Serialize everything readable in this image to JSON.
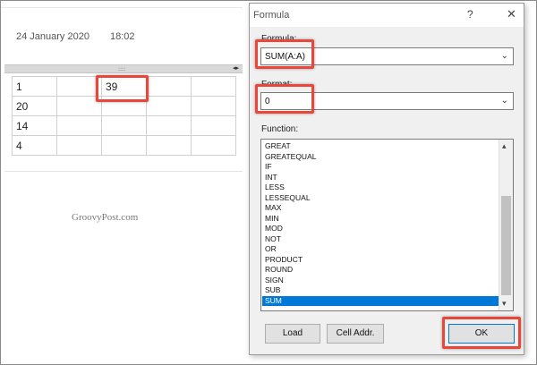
{
  "note": {
    "date": "24 January 2020",
    "time": "18:02",
    "table": [
      [
        "1",
        "",
        "39",
        "",
        ""
      ],
      [
        "20",
        "",
        "",
        "",
        ""
      ],
      [
        "14",
        "",
        "",
        "",
        ""
      ],
      [
        "4",
        "",
        "",
        "",
        ""
      ]
    ],
    "grip": "::::",
    "scroll_arrows": "◂▸"
  },
  "watermark": "GroovyPost.com",
  "dialog": {
    "title": "Formula",
    "help": "?",
    "close": "✕",
    "formula_label": "Formula:",
    "formula_value": "SUM(A:A)",
    "format_label": "Format:",
    "format_value": "0",
    "function_label": "Function:",
    "functions": [
      "GREAT",
      "GREATEQUAL",
      "IF",
      "INT",
      "LESS",
      "LESSEQUAL",
      "MAX",
      "MIN",
      "MOD",
      "NOT",
      "OR",
      "PRODUCT",
      "ROUND",
      "SIGN",
      "SUB",
      "SUM"
    ],
    "selected_function": "SUM",
    "load_button": "Load",
    "cell_addr_button": "Cell Addr.",
    "ok_button": "OK"
  },
  "icons": {
    "chevron": "⌄",
    "scroll_up": "▴",
    "scroll_down": "▾"
  },
  "colors": {
    "highlight": "#e8473a",
    "selection": "#0078d7"
  }
}
